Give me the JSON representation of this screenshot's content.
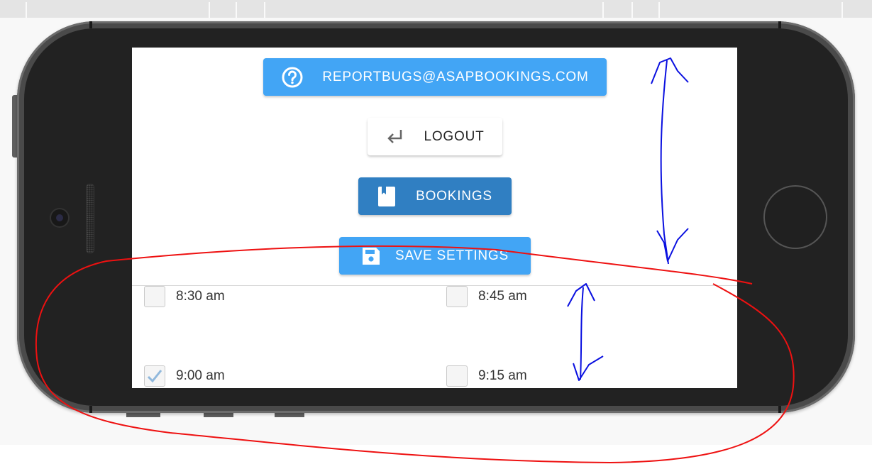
{
  "screen": {
    "buttons": {
      "email": {
        "label": "REPORTBUGS@ASAPBOOKINGS.COM",
        "icon": "help-circle-icon",
        "color": "#42a5f5"
      },
      "logout": {
        "label": "LOGOUT",
        "icon": "return-arrow-icon",
        "color": "#ffffff"
      },
      "bookings": {
        "label": "BOOKINGS",
        "icon": "book-icon",
        "color": "#307fc2"
      },
      "save": {
        "label": "SAVE SETTINGS",
        "icon": "save-disk-icon",
        "color": "#42a5f5"
      }
    },
    "time_slots": [
      {
        "label": "8:30 am",
        "checked": false
      },
      {
        "label": "8:45 am",
        "checked": false
      },
      {
        "label": "9:00 am",
        "checked": true
      },
      {
        "label": "9:15 am",
        "checked": false
      }
    ]
  },
  "annotations": {
    "arrows_color": "#0a10e0",
    "outline_color": "#ee1111"
  }
}
